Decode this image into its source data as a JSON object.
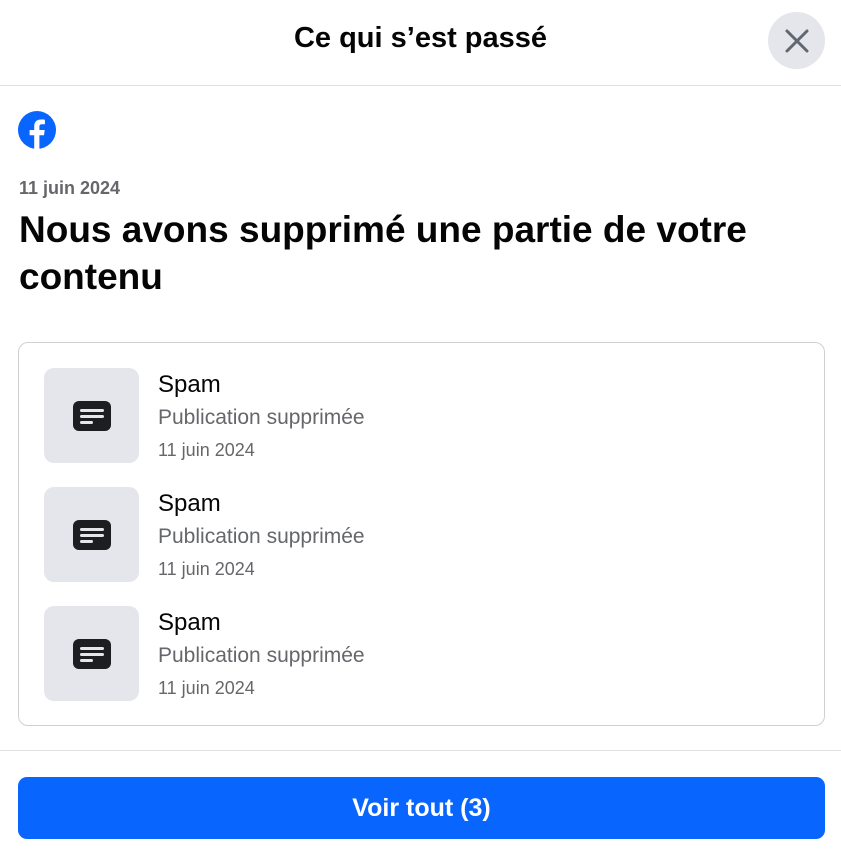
{
  "dialog": {
    "title": "Ce qui s’est passé",
    "close_icon": "close-icon"
  },
  "brand": {
    "logo_icon": "facebook-logo-icon",
    "color": "#0866ff"
  },
  "notice": {
    "date": "11 juin 2024",
    "headline": "Nous avons supprimé une partie de votre contenu"
  },
  "items": [
    {
      "icon": "post-icon",
      "title": "Spam",
      "subtitle": "Publication supprimée",
      "date": "11 juin 2024"
    },
    {
      "icon": "post-icon",
      "title": "Spam",
      "subtitle": "Publication supprimée",
      "date": "11 juin 2024"
    },
    {
      "icon": "post-icon",
      "title": "Spam",
      "subtitle": "Publication supprimée",
      "date": "11 juin 2024"
    }
  ],
  "actions": {
    "see_all_label": "Voir tout (3)"
  }
}
